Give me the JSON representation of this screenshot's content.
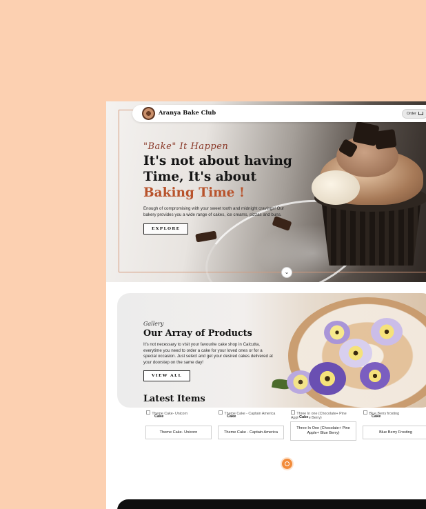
{
  "nav": {
    "brand": "Aranya Bake Club",
    "order_label": "Order"
  },
  "hero": {
    "script": "\"Bake\" It Happen",
    "title_line1": "It's not about having",
    "title_line2": "Time, It's about",
    "title_accent": "Baking Time !",
    "description": "Enough of compromising with your sweet tooth and midnight cravings! Our bakery provides you a wide range of cakes, ice creams, pizzas and buns.",
    "cta": "EXPLORE"
  },
  "gallery": {
    "script": "Gallery",
    "title": "Our Array of Products",
    "description": "It's not necessary to visit your favourite cake shop in Calcutta, everytime you need to order a cake for your loved ones or for a special occasion. Just select and get your desired cakes delivered at your doorstep on the same day!",
    "cta": "VIEW ALL"
  },
  "latest": {
    "title": "Latest Items",
    "items": [
      {
        "alt": "Theme Cake- Unicorn",
        "category": "Cake",
        "name": "Theme Cake- Unicorn"
      },
      {
        "alt": "Theme Cake - Captain America",
        "category": "Cake",
        "name": "Theme Cake - Captain America"
      },
      {
        "alt": "Three In one (Chocolate+ Pine Apple+ Blue Berry)",
        "category": "Cake",
        "name": "Three In One (Chocolate+ Pine Apple+ Blue Berry)"
      },
      {
        "alt": "Blue Berry frosting",
        "category": "Cake",
        "name": "Blue Berry Frosting"
      }
    ]
  },
  "icons": {
    "logo": "bakery-logo-icon",
    "cart": "cart-icon",
    "scroll": "chevron-down-icon",
    "chat": "whatsapp-icon"
  },
  "colors": {
    "background": "#fcd0b1",
    "accent": "#b8532c",
    "chat": "#f28b3a"
  }
}
